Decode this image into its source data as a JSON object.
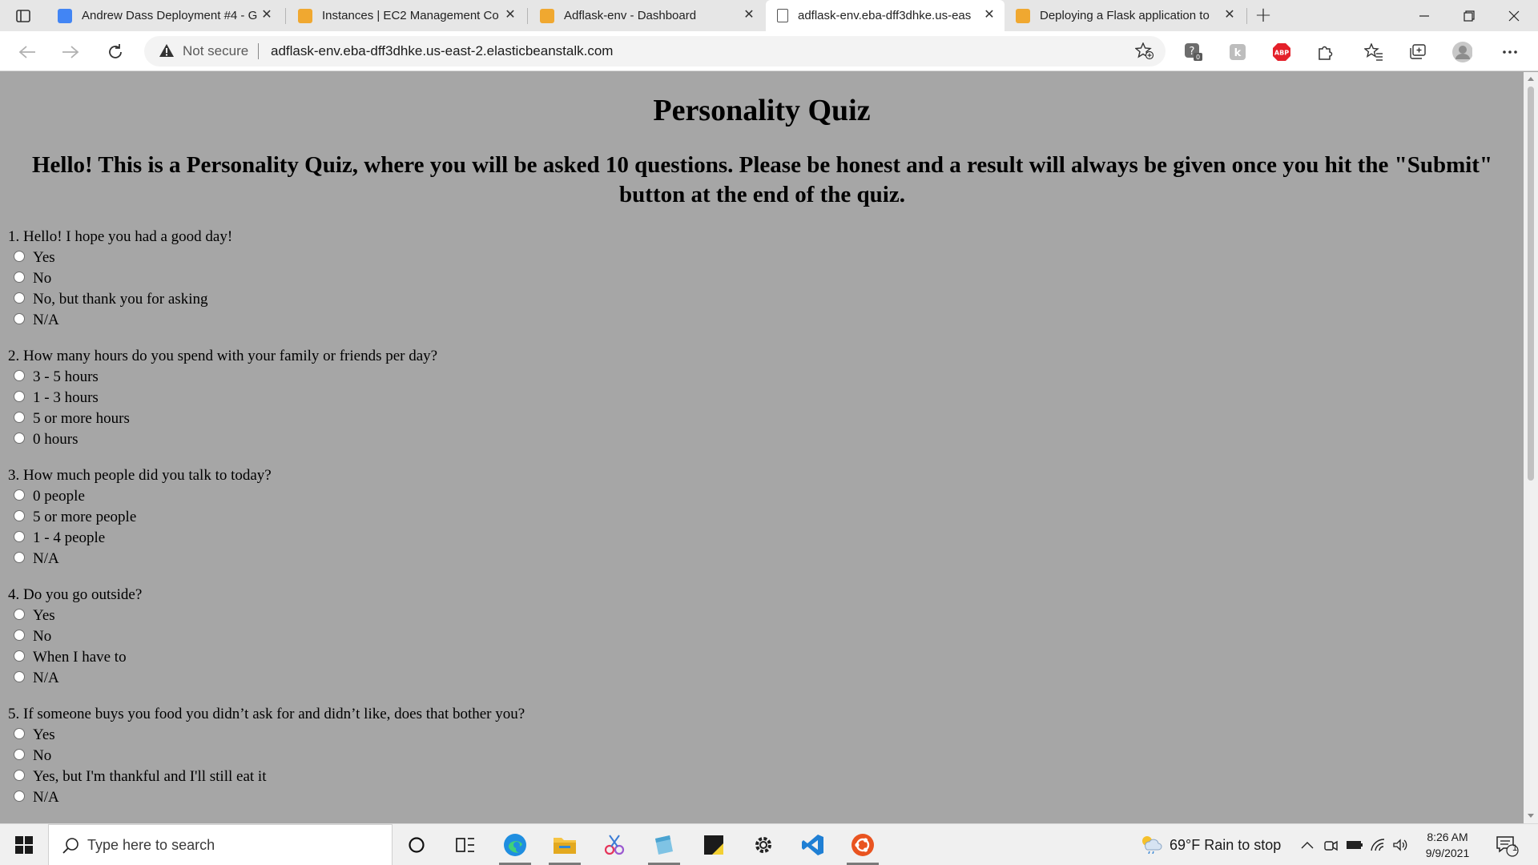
{
  "tabs": [
    {
      "label": "Andrew Dass Deployment #4 - G",
      "icon": "docs-icon",
      "color": "#4285f4"
    },
    {
      "label": "Instances | EC2 Management Co",
      "icon": "aws-cube-icon",
      "color": "#f0a830"
    },
    {
      "label": "Adflask-env - Dashboard",
      "icon": "aws-cube-icon",
      "color": "#f0a830"
    },
    {
      "label": "adflask-env.eba-dff3dhke.us-eas",
      "icon": "page-icon",
      "color": "#555555"
    },
    {
      "label": "Deploying a Flask application to",
      "icon": "aws-docs-icon",
      "color": "#f0a830"
    }
  ],
  "address_bar": {
    "security_label": "Not secure",
    "url": "adflask-env.eba-dff3dhke.us-east-2.elasticbeanstalk.com"
  },
  "page": {
    "title": "Personality Quiz",
    "intro": "Hello! This is a Personality Quiz, where you will be asked 10 questions. Please be honest and a result will always be given once you hit the \"Submit\" button at the end of the quiz.",
    "questions": [
      {
        "text": "1. Hello! I hope you had a good day!",
        "options": [
          "Yes",
          "No",
          "No, but thank you for asking",
          "N/A"
        ]
      },
      {
        "text": "2. How many hours do you spend with your family or friends per day?",
        "options": [
          "3 - 5 hours",
          "1 - 3 hours",
          "5 or more hours",
          "0 hours"
        ]
      },
      {
        "text": "3. How much people did you talk to today?",
        "options": [
          "0 people",
          "5 or more people",
          "1 - 4 people",
          "N/A"
        ]
      },
      {
        "text": "4. Do you go outside?",
        "options": [
          "Yes",
          "No",
          "When I have to",
          "N/A"
        ]
      },
      {
        "text": "5. If someone buys you food you didn’t ask for and didn’t like, does that bother you?",
        "options": [
          "Yes",
          "No",
          "Yes, but I'm thankful and I'll still eat it",
          "N/A"
        ]
      }
    ]
  },
  "taskbar": {
    "search_placeholder": "Type here to search",
    "weather": "69°F  Rain to stop",
    "time": "8:26 AM",
    "date": "9/9/2021",
    "notification_count": "1"
  }
}
